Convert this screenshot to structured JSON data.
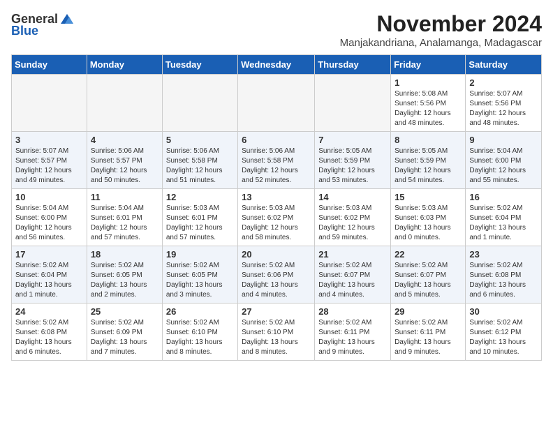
{
  "logo": {
    "general": "General",
    "blue": "Blue"
  },
  "title": "November 2024",
  "subtitle": "Manjakandriana, Analamanga, Madagascar",
  "weekdays": [
    "Sunday",
    "Monday",
    "Tuesday",
    "Wednesday",
    "Thursday",
    "Friday",
    "Saturday"
  ],
  "weeks": [
    [
      {
        "day": "",
        "info": ""
      },
      {
        "day": "",
        "info": ""
      },
      {
        "day": "",
        "info": ""
      },
      {
        "day": "",
        "info": ""
      },
      {
        "day": "",
        "info": ""
      },
      {
        "day": "1",
        "info": "Sunrise: 5:08 AM\nSunset: 5:56 PM\nDaylight: 12 hours\nand 48 minutes."
      },
      {
        "day": "2",
        "info": "Sunrise: 5:07 AM\nSunset: 5:56 PM\nDaylight: 12 hours\nand 48 minutes."
      }
    ],
    [
      {
        "day": "3",
        "info": "Sunrise: 5:07 AM\nSunset: 5:57 PM\nDaylight: 12 hours\nand 49 minutes."
      },
      {
        "day": "4",
        "info": "Sunrise: 5:06 AM\nSunset: 5:57 PM\nDaylight: 12 hours\nand 50 minutes."
      },
      {
        "day": "5",
        "info": "Sunrise: 5:06 AM\nSunset: 5:58 PM\nDaylight: 12 hours\nand 51 minutes."
      },
      {
        "day": "6",
        "info": "Sunrise: 5:06 AM\nSunset: 5:58 PM\nDaylight: 12 hours\nand 52 minutes."
      },
      {
        "day": "7",
        "info": "Sunrise: 5:05 AM\nSunset: 5:59 PM\nDaylight: 12 hours\nand 53 minutes."
      },
      {
        "day": "8",
        "info": "Sunrise: 5:05 AM\nSunset: 5:59 PM\nDaylight: 12 hours\nand 54 minutes."
      },
      {
        "day": "9",
        "info": "Sunrise: 5:04 AM\nSunset: 6:00 PM\nDaylight: 12 hours\nand 55 minutes."
      }
    ],
    [
      {
        "day": "10",
        "info": "Sunrise: 5:04 AM\nSunset: 6:00 PM\nDaylight: 12 hours\nand 56 minutes."
      },
      {
        "day": "11",
        "info": "Sunrise: 5:04 AM\nSunset: 6:01 PM\nDaylight: 12 hours\nand 57 minutes."
      },
      {
        "day": "12",
        "info": "Sunrise: 5:03 AM\nSunset: 6:01 PM\nDaylight: 12 hours\nand 57 minutes."
      },
      {
        "day": "13",
        "info": "Sunrise: 5:03 AM\nSunset: 6:02 PM\nDaylight: 12 hours\nand 58 minutes."
      },
      {
        "day": "14",
        "info": "Sunrise: 5:03 AM\nSunset: 6:02 PM\nDaylight: 12 hours\nand 59 minutes."
      },
      {
        "day": "15",
        "info": "Sunrise: 5:03 AM\nSunset: 6:03 PM\nDaylight: 13 hours\nand 0 minutes."
      },
      {
        "day": "16",
        "info": "Sunrise: 5:02 AM\nSunset: 6:04 PM\nDaylight: 13 hours\nand 1 minute."
      }
    ],
    [
      {
        "day": "17",
        "info": "Sunrise: 5:02 AM\nSunset: 6:04 PM\nDaylight: 13 hours\nand 1 minute."
      },
      {
        "day": "18",
        "info": "Sunrise: 5:02 AM\nSunset: 6:05 PM\nDaylight: 13 hours\nand 2 minutes."
      },
      {
        "day": "19",
        "info": "Sunrise: 5:02 AM\nSunset: 6:05 PM\nDaylight: 13 hours\nand 3 minutes."
      },
      {
        "day": "20",
        "info": "Sunrise: 5:02 AM\nSunset: 6:06 PM\nDaylight: 13 hours\nand 4 minutes."
      },
      {
        "day": "21",
        "info": "Sunrise: 5:02 AM\nSunset: 6:07 PM\nDaylight: 13 hours\nand 4 minutes."
      },
      {
        "day": "22",
        "info": "Sunrise: 5:02 AM\nSunset: 6:07 PM\nDaylight: 13 hours\nand 5 minutes."
      },
      {
        "day": "23",
        "info": "Sunrise: 5:02 AM\nSunset: 6:08 PM\nDaylight: 13 hours\nand 6 minutes."
      }
    ],
    [
      {
        "day": "24",
        "info": "Sunrise: 5:02 AM\nSunset: 6:08 PM\nDaylight: 13 hours\nand 6 minutes."
      },
      {
        "day": "25",
        "info": "Sunrise: 5:02 AM\nSunset: 6:09 PM\nDaylight: 13 hours\nand 7 minutes."
      },
      {
        "day": "26",
        "info": "Sunrise: 5:02 AM\nSunset: 6:10 PM\nDaylight: 13 hours\nand 8 minutes."
      },
      {
        "day": "27",
        "info": "Sunrise: 5:02 AM\nSunset: 6:10 PM\nDaylight: 13 hours\nand 8 minutes."
      },
      {
        "day": "28",
        "info": "Sunrise: 5:02 AM\nSunset: 6:11 PM\nDaylight: 13 hours\nand 9 minutes."
      },
      {
        "day": "29",
        "info": "Sunrise: 5:02 AM\nSunset: 6:11 PM\nDaylight: 13 hours\nand 9 minutes."
      },
      {
        "day": "30",
        "info": "Sunrise: 5:02 AM\nSunset: 6:12 PM\nDaylight: 13 hours\nand 10 minutes."
      }
    ]
  ]
}
